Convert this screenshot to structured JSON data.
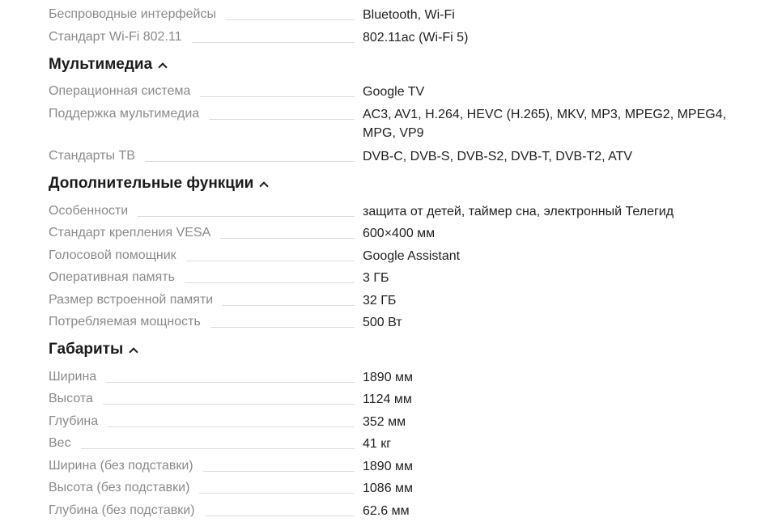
{
  "top_specs": [
    {
      "name": "Беспроводные интерфейсы",
      "value": "Bluetooth, Wi-Fi"
    },
    {
      "name": "Стандарт Wi-Fi 802.11",
      "value": "802.11ac (Wi-Fi 5)"
    }
  ],
  "sections": {
    "multimedia": {
      "title": "Мультимедиа",
      "specs": [
        {
          "name": "Операционная система",
          "value": "Google TV"
        },
        {
          "name": "Поддержка мультимедиа",
          "value": "AC3, AV1, H.264, HEVC (H.265), MKV, MP3, MPEG2, MPEG4, MPG, VP9"
        },
        {
          "name": "Стандарты ТВ",
          "value": "DVB-C, DVB-S, DVB-S2, DVB-T, DVB-T2, ATV"
        }
      ]
    },
    "extra": {
      "title": "Дополнительные функции",
      "specs": [
        {
          "name": "Особенности",
          "value": "защита от детей, таймер сна, электронный Телегид"
        },
        {
          "name": "Стандарт крепления VESA",
          "value": "600×400 мм"
        },
        {
          "name": "Голосовой помощник",
          "value": "Google Assistant"
        },
        {
          "name": "Оперативная память",
          "value": "3 ГБ"
        },
        {
          "name": "Размер встроенной памяти",
          "value": "32 ГБ"
        },
        {
          "name": "Потребляемая мощность",
          "value": "500 Вт"
        }
      ]
    },
    "dimensions": {
      "title": "Габариты",
      "specs": [
        {
          "name": "Ширина",
          "value": "1890 мм"
        },
        {
          "name": "Высота",
          "value": "1124 мм"
        },
        {
          "name": "Глубина",
          "value": "352 мм"
        },
        {
          "name": "Вес",
          "value": "41 кг"
        },
        {
          "name": "Ширина (без подставки)",
          "value": "1890 мм"
        },
        {
          "name": "Высота (без подставки)",
          "value": "1086 мм"
        },
        {
          "name": "Глубина (без подставки)",
          "value": "62.6 мм"
        }
      ]
    }
  },
  "icons": {
    "collapse_chevron": "chevron-up-icon"
  }
}
